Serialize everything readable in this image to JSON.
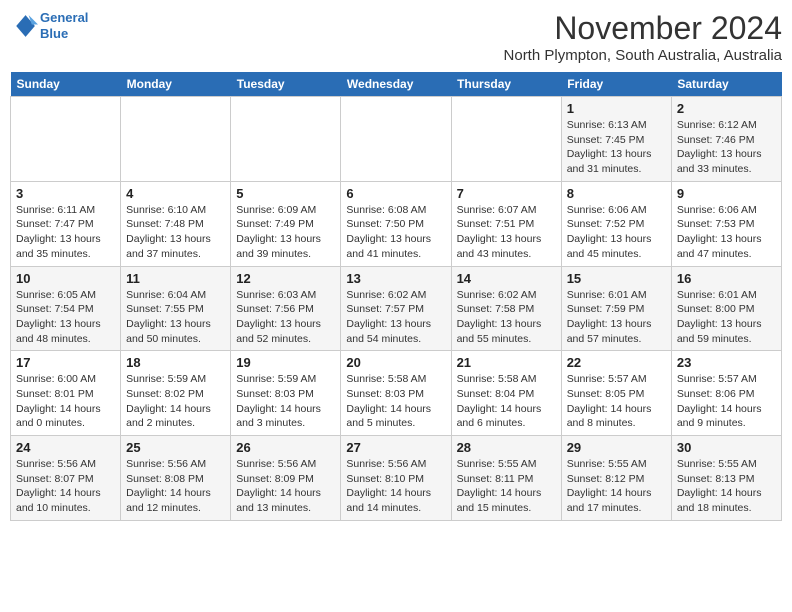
{
  "logo": {
    "line1": "General",
    "line2": "Blue"
  },
  "title": "November 2024",
  "location": "North Plympton, South Australia, Australia",
  "weekdays": [
    "Sunday",
    "Monday",
    "Tuesday",
    "Wednesday",
    "Thursday",
    "Friday",
    "Saturday"
  ],
  "weeks": [
    [
      {
        "day": "",
        "info": ""
      },
      {
        "day": "",
        "info": ""
      },
      {
        "day": "",
        "info": ""
      },
      {
        "day": "",
        "info": ""
      },
      {
        "day": "",
        "info": ""
      },
      {
        "day": "1",
        "info": "Sunrise: 6:13 AM\nSunset: 7:45 PM\nDaylight: 13 hours and 31 minutes."
      },
      {
        "day": "2",
        "info": "Sunrise: 6:12 AM\nSunset: 7:46 PM\nDaylight: 13 hours and 33 minutes."
      }
    ],
    [
      {
        "day": "3",
        "info": "Sunrise: 6:11 AM\nSunset: 7:47 PM\nDaylight: 13 hours and 35 minutes."
      },
      {
        "day": "4",
        "info": "Sunrise: 6:10 AM\nSunset: 7:48 PM\nDaylight: 13 hours and 37 minutes."
      },
      {
        "day": "5",
        "info": "Sunrise: 6:09 AM\nSunset: 7:49 PM\nDaylight: 13 hours and 39 minutes."
      },
      {
        "day": "6",
        "info": "Sunrise: 6:08 AM\nSunset: 7:50 PM\nDaylight: 13 hours and 41 minutes."
      },
      {
        "day": "7",
        "info": "Sunrise: 6:07 AM\nSunset: 7:51 PM\nDaylight: 13 hours and 43 minutes."
      },
      {
        "day": "8",
        "info": "Sunrise: 6:06 AM\nSunset: 7:52 PM\nDaylight: 13 hours and 45 minutes."
      },
      {
        "day": "9",
        "info": "Sunrise: 6:06 AM\nSunset: 7:53 PM\nDaylight: 13 hours and 47 minutes."
      }
    ],
    [
      {
        "day": "10",
        "info": "Sunrise: 6:05 AM\nSunset: 7:54 PM\nDaylight: 13 hours and 48 minutes."
      },
      {
        "day": "11",
        "info": "Sunrise: 6:04 AM\nSunset: 7:55 PM\nDaylight: 13 hours and 50 minutes."
      },
      {
        "day": "12",
        "info": "Sunrise: 6:03 AM\nSunset: 7:56 PM\nDaylight: 13 hours and 52 minutes."
      },
      {
        "day": "13",
        "info": "Sunrise: 6:02 AM\nSunset: 7:57 PM\nDaylight: 13 hours and 54 minutes."
      },
      {
        "day": "14",
        "info": "Sunrise: 6:02 AM\nSunset: 7:58 PM\nDaylight: 13 hours and 55 minutes."
      },
      {
        "day": "15",
        "info": "Sunrise: 6:01 AM\nSunset: 7:59 PM\nDaylight: 13 hours and 57 minutes."
      },
      {
        "day": "16",
        "info": "Sunrise: 6:01 AM\nSunset: 8:00 PM\nDaylight: 13 hours and 59 minutes."
      }
    ],
    [
      {
        "day": "17",
        "info": "Sunrise: 6:00 AM\nSunset: 8:01 PM\nDaylight: 14 hours and 0 minutes."
      },
      {
        "day": "18",
        "info": "Sunrise: 5:59 AM\nSunset: 8:02 PM\nDaylight: 14 hours and 2 minutes."
      },
      {
        "day": "19",
        "info": "Sunrise: 5:59 AM\nSunset: 8:03 PM\nDaylight: 14 hours and 3 minutes."
      },
      {
        "day": "20",
        "info": "Sunrise: 5:58 AM\nSunset: 8:03 PM\nDaylight: 14 hours and 5 minutes."
      },
      {
        "day": "21",
        "info": "Sunrise: 5:58 AM\nSunset: 8:04 PM\nDaylight: 14 hours and 6 minutes."
      },
      {
        "day": "22",
        "info": "Sunrise: 5:57 AM\nSunset: 8:05 PM\nDaylight: 14 hours and 8 minutes."
      },
      {
        "day": "23",
        "info": "Sunrise: 5:57 AM\nSunset: 8:06 PM\nDaylight: 14 hours and 9 minutes."
      }
    ],
    [
      {
        "day": "24",
        "info": "Sunrise: 5:56 AM\nSunset: 8:07 PM\nDaylight: 14 hours and 10 minutes."
      },
      {
        "day": "25",
        "info": "Sunrise: 5:56 AM\nSunset: 8:08 PM\nDaylight: 14 hours and 12 minutes."
      },
      {
        "day": "26",
        "info": "Sunrise: 5:56 AM\nSunset: 8:09 PM\nDaylight: 14 hours and 13 minutes."
      },
      {
        "day": "27",
        "info": "Sunrise: 5:56 AM\nSunset: 8:10 PM\nDaylight: 14 hours and 14 minutes."
      },
      {
        "day": "28",
        "info": "Sunrise: 5:55 AM\nSunset: 8:11 PM\nDaylight: 14 hours and 15 minutes."
      },
      {
        "day": "29",
        "info": "Sunrise: 5:55 AM\nSunset: 8:12 PM\nDaylight: 14 hours and 17 minutes."
      },
      {
        "day": "30",
        "info": "Sunrise: 5:55 AM\nSunset: 8:13 PM\nDaylight: 14 hours and 18 minutes."
      }
    ]
  ]
}
